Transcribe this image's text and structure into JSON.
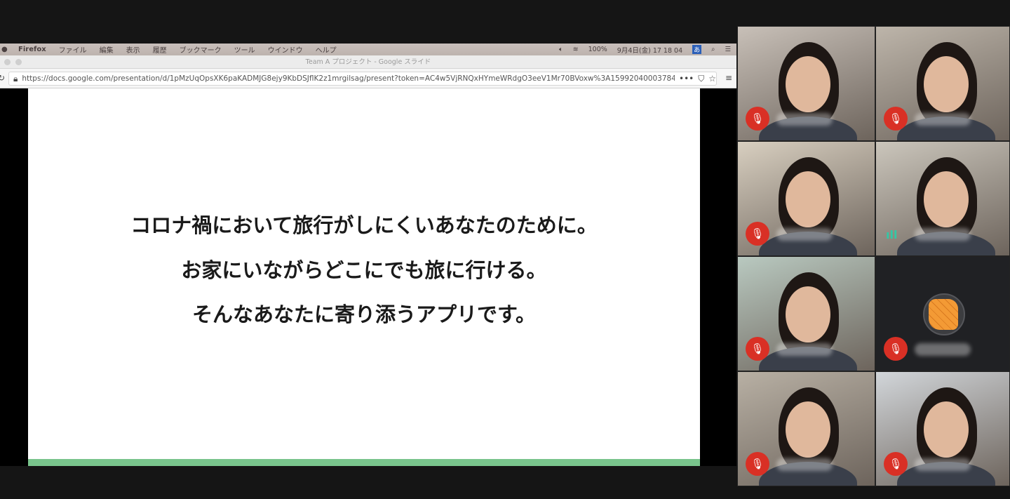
{
  "menubar": {
    "app": "Firefox",
    "items": [
      "ファイル",
      "編集",
      "表示",
      "履歴",
      "ブックマーク",
      "ツール",
      "ウインドウ",
      "ヘルプ"
    ],
    "battery": "100%",
    "clock": "9月4日(金)  17 18 04",
    "ime": "あ"
  },
  "window_title": "Team A プロジェクト - Google スライド",
  "url": "https://docs.google.com/presentation/d/1pMzUqOpsXK6paKADMJG8ejy9KbDSJflK2z1mrgilsag/present?token=AC4w5VjRNQxHYmeWRdgO3eeV1Mr70BVoxw%3A15992040003784",
  "slide": {
    "lines": [
      "コロナ禍において旅行がしにくいあなたのために。",
      "お家にいながらどこにでも旅に行ける。",
      "そんなあなたに寄り添うアプリです。"
    ],
    "accent": "#79c48c"
  },
  "participants": [
    {
      "bg": "#c8c0b8",
      "muted": true
    },
    {
      "bg": "#bdb5aa",
      "muted": true
    },
    {
      "bg": "#d8cfc0",
      "muted": true
    },
    {
      "bg": "#cbc6bc",
      "muted": false,
      "speaking": true
    },
    {
      "bg": "#b9c9c0",
      "muted": true
    },
    {
      "bg": "#202124",
      "muted": true,
      "avatar": true
    },
    {
      "bg": "#b8b0a4",
      "muted": true
    },
    {
      "bg": "#d2d6da",
      "muted": true
    }
  ]
}
